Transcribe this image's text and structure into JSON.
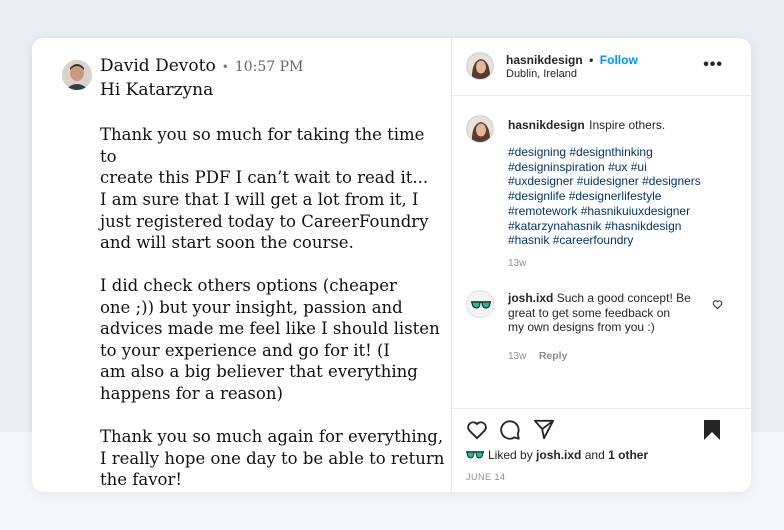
{
  "message": {
    "sender_name": "David Devoto",
    "separator": "•",
    "time": "10:57 PM",
    "greeting": "Hi Katarzyna",
    "paragraphs": [
      "Thank you so much for taking the time to\ncreate this PDF I can’t wait to read it...",
      "I am sure that I will get a lot from it, I\njust registered today to CareerFoundry\nand will start soon the course.",
      "I did check others options (cheaper\none ;)) but your insight, passion and\nadvices made me feel like I should listen\nto your experience and go for it! (I\nam also a big believer that everything\nhappens for a reason)",
      "Thank you so much again for everything,\nI really hope one day to be able to return\nthe favor!"
    ]
  },
  "post": {
    "username": "hasnikdesign",
    "dot": "•",
    "follow_label": "Follow",
    "location": "Dublin, Ireland",
    "more_icon": "more-horizontal-icon",
    "caption": {
      "username": "hasnikdesign",
      "text": "Inspire others.",
      "hashtags": [
        "#designing #designthinking",
        "#designinspiration #ux #ui",
        "#uxdesigner #uidesigner #designers",
        "#designlife #designerlifestyle",
        "#remotework #hasnikuiuxdesigner",
        "#katarzynahasnik #hasnikdesign",
        "#hasnik #careerfoundry"
      ],
      "age": "13w"
    },
    "comment": {
      "username": "josh.ixd",
      "text_lines": [
        "Such a good concept! Be",
        "great to get some feedback on",
        "my own designs from you :)"
      ],
      "age": "13w",
      "reply_label": "Reply",
      "like_icon": "heart-outline-icon"
    },
    "actions": {
      "like_icon": "heart-icon",
      "comment_icon": "comment-icon",
      "share_icon": "send-icon",
      "save_icon": "bookmark-icon"
    },
    "likes": {
      "prefix": "Liked by",
      "user": "josh.ixd",
      "conj": "and",
      "others": "1 other"
    },
    "date": "JUNE 14"
  }
}
